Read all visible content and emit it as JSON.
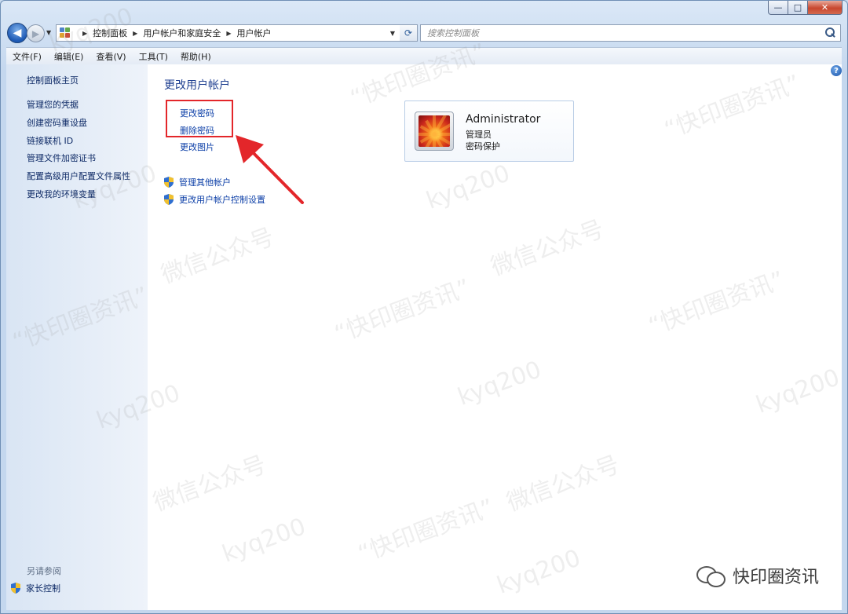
{
  "window": {
    "controls": {
      "minimize": "—",
      "maximize": "□",
      "close": "✕"
    }
  },
  "address": {
    "crumbs": [
      "控制面板",
      "用户帐户和家庭安全",
      "用户帐户"
    ],
    "search_placeholder": "搜索控制面板"
  },
  "menu": [
    "文件(F)",
    "编辑(E)",
    "查看(V)",
    "工具(T)",
    "帮助(H)"
  ],
  "sidebar": {
    "items": [
      "控制面板主页",
      "管理您的凭据",
      "创建密码重设盘",
      "链接联机 ID",
      "管理文件加密证书",
      "配置高级用户配置文件属性",
      "更改我的环境变量"
    ],
    "see_also_label": "另请参阅",
    "parental_controls": "家长控制"
  },
  "main": {
    "heading": "更改用户帐户",
    "links": [
      "更改密码",
      "删除密码",
      "更改图片"
    ],
    "shield_links": [
      "管理其他帐户",
      "更改用户帐户控制设置"
    ],
    "help": "?"
  },
  "account": {
    "name": "Administrator",
    "role": "管理员",
    "status": "密码保护"
  },
  "watermark": {
    "brand": "快印圈资讯",
    "texts": [
      "kyq200",
      "微信公众号",
      "“快印圈资讯”"
    ]
  },
  "colors": {
    "link": "#0b3ea7",
    "highlight_box": "#e3262a",
    "heading": "#1f3f90"
  },
  "icons": [
    "back-arrow-icon",
    "forward-arrow-icon",
    "control-panel-icon",
    "refresh-icon",
    "search-icon",
    "help-icon",
    "shield-icon",
    "wechat-icon"
  ]
}
